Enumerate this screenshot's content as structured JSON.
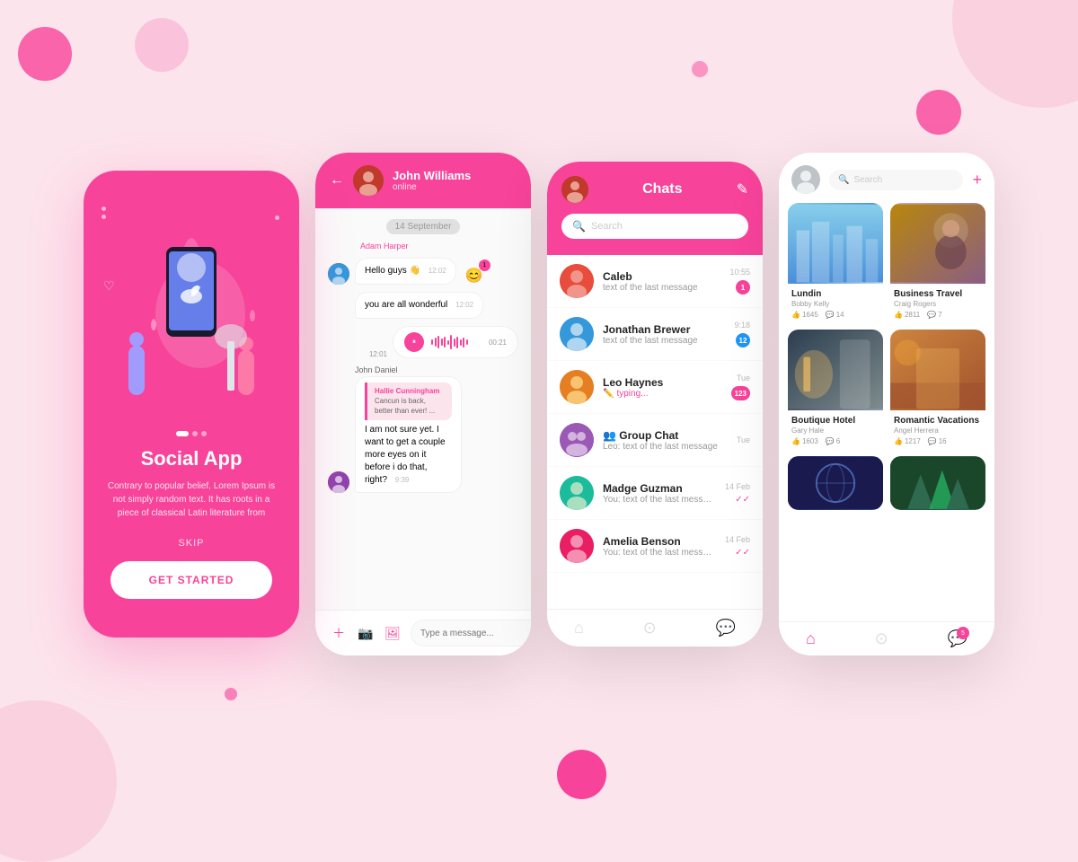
{
  "bg": {
    "color": "#fce4ec"
  },
  "screen1": {
    "title": "Social App",
    "description": "Contrary to popular belief, Lorem Ipsum is not simply random text. It has roots in a piece of classical Latin literature from",
    "skip_label": "SKIP",
    "btn_label": "GET STARTED"
  },
  "screen2": {
    "header": {
      "username": "John Williams",
      "status": "online"
    },
    "date_divider": "14 September",
    "messages": [
      {
        "sender": "Adam Harper",
        "text": "Hello guys 👋",
        "time": "12:02",
        "type": "received"
      },
      {
        "text": "you are all wonderful",
        "time": "12:02",
        "type": "received_no_avatar"
      },
      {
        "type": "audio",
        "duration": "00:21",
        "time": "12:01"
      },
      {
        "sender": "John Daniel",
        "quoted_name": "Hallie Cunningham",
        "quoted_text": "Cancun is back, better than ever! ...",
        "text": "I am not sure yet. I want to get a couple more eyes on it before i do that, right?",
        "time": "9:39",
        "type": "sent"
      }
    ],
    "input": {
      "placeholder": "Type a message..."
    }
  },
  "screen3": {
    "header": {
      "title": "Chats",
      "search_placeholder": "Search"
    },
    "chats": [
      {
        "name": "Caleb",
        "preview": "text of the last message",
        "time": "10:55",
        "unread": "1",
        "color": "#e74c3c"
      },
      {
        "name": "Jonathan Brewer",
        "preview": "text of the last message",
        "time": "9:18",
        "unread": "12",
        "color": "#3498db"
      },
      {
        "name": "Leo Haynes",
        "preview": "typing...",
        "time": "Tue",
        "unread": "123",
        "typing": true,
        "color": "#e67e22"
      },
      {
        "name": "Group Chat",
        "preview": "Leo: text of the last message",
        "time": "Tue",
        "group": true,
        "color": "#9b59b6"
      },
      {
        "name": "Madge Guzman",
        "preview": "You: text of the last message",
        "time": "14 Feb",
        "double_check": true,
        "color": "#1abc9c"
      },
      {
        "name": "Amelia Benson",
        "preview": "You: text of the last message",
        "time": "14 Feb",
        "double_check": true,
        "color": "#e91e63"
      }
    ]
  },
  "screen4": {
    "header": {
      "search_placeholder": "Search"
    },
    "cards": [
      {
        "title": "Lundin",
        "author": "Bobby Kelly",
        "likes": "1645",
        "comments": "14",
        "type": "city"
      },
      {
        "title": "Business Travel",
        "author": "Craig Rogers",
        "likes": "2811",
        "comments": "7",
        "type": "couple"
      },
      {
        "title": "Boutique Hotel",
        "author": "Gary Hale",
        "likes": "1603",
        "comments": "6",
        "type": "hotel"
      },
      {
        "title": "Romantic Vacations",
        "author": "Angel Herrera",
        "likes": "1217",
        "comments": "16",
        "type": "vacation"
      },
      {
        "title": "",
        "author": "",
        "likes": "",
        "comments": "",
        "type": "globe"
      },
      {
        "title": "",
        "author": "",
        "likes": "",
        "comments": "",
        "type": "forest"
      }
    ],
    "nav_badge": "5"
  }
}
